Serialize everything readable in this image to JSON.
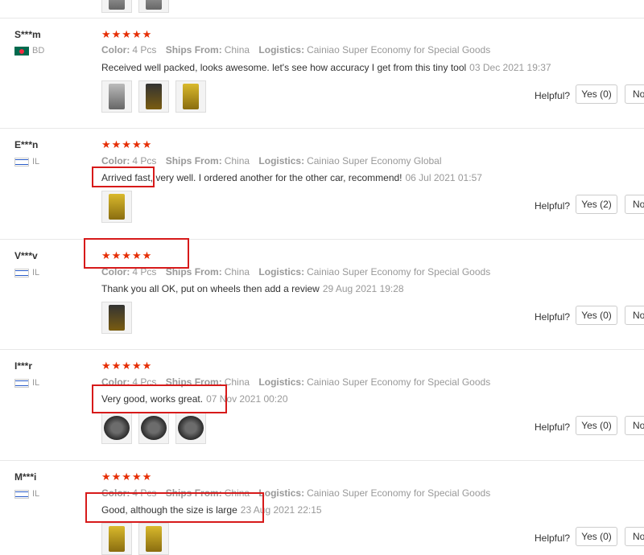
{
  "labels": {
    "color_label": "Color:",
    "ships_label": "Ships From:",
    "logistics_label": "Logistics:",
    "helpful_label": "Helpful?",
    "no_label": "No"
  },
  "rating_stars": "★★★★★",
  "reviews": [
    {
      "user": "S***m",
      "country": "BD",
      "color": "4 Pcs",
      "ships_from": "China",
      "logistics": "Cainiao Super Economy for Special Goods",
      "text": "Received well packed, looks awesome. let's see how accuracy I get from this tiny tool",
      "date": "03 Dec 2021 19:37",
      "yes": "Yes (0)"
    },
    {
      "user": "E***n",
      "country": "IL",
      "color": "4 Pcs",
      "ships_from": "China",
      "logistics": "Cainiao Super Economy Global",
      "text": "Arrived fast, very well. I ordered another for the other car, recommend!",
      "date": "06 Jul 2021 01:57",
      "yes": "Yes (2)"
    },
    {
      "user": "V***v",
      "country": "IL",
      "color": "4 Pcs",
      "ships_from": "China",
      "logistics": "Cainiao Super Economy for Special Goods",
      "text": "Thank you all OK, put on wheels then add a review",
      "date": "29 Aug 2021 19:28",
      "yes": "Yes (0)"
    },
    {
      "user": "I***r",
      "country": "IL",
      "color": "4 Pcs",
      "ships_from": "China",
      "logistics": "Cainiao Super Economy for Special Goods",
      "text": "Very good, works great.",
      "date": "07 Nov 2021 00:20",
      "yes": "Yes (0)"
    },
    {
      "user": "M***i",
      "country": "IL",
      "color": "4 Pcs",
      "ships_from": "China",
      "logistics": "Cainiao Super Economy for Special Goods",
      "text": "Good, although the size is large",
      "date": "23 Aug 2021 22:15",
      "yes": "Yes (0)"
    }
  ],
  "colors": {
    "star": "#e62e04",
    "highlight_box": "#d71a1a"
  }
}
